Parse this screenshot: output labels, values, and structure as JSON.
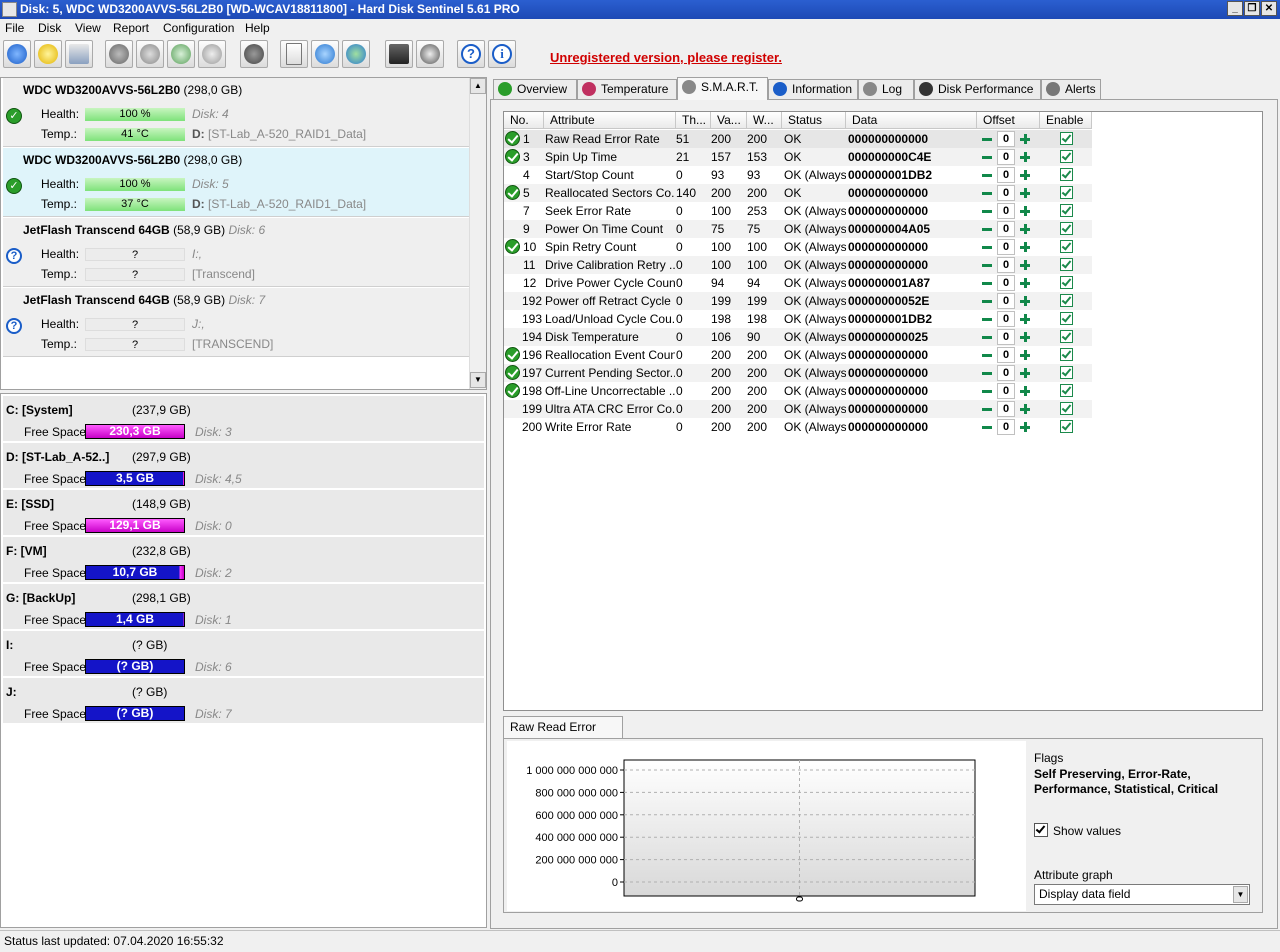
{
  "window": {
    "title": "Disk: 5, WDC WD3200AVVS-56L2B0 [WD-WCAV18811800]  -  Hard Disk Sentinel 5.61 PRO",
    "minimize": "_",
    "restore": "❐",
    "close": "✕"
  },
  "menu": [
    "File",
    "Disk",
    "View",
    "Report",
    "Configuration",
    "Help"
  ],
  "toolbar": {
    "icons": [
      "refresh-icon",
      "warning-icon",
      "disk-icon",
      "disk-gray-icon",
      "disk-info-icon",
      "disk-check-icon",
      "disk-tools-icon",
      "disk-blob-icon",
      "report-icon",
      "update-icon",
      "network-icon",
      "alert-config-icon",
      "sound-icon",
      "help-icon",
      "info-icon"
    ],
    "unregistered": "Unregistered version, please register.",
    "help_glyph": "?",
    "info_glyph": "i"
  },
  "disks": [
    {
      "name": "WDC WD3200AVVS-56L2B0",
      "size": "(298,0 GB)",
      "disk_no": "",
      "status": "ok",
      "health_label": "Health:",
      "health": "100 %",
      "health_info": "Disk: 4",
      "temp_label": "Temp.:",
      "temp": "41 °C",
      "drive": "D:",
      "drive_name": "[ST-Lab_A-520_RAID1_Data]"
    },
    {
      "name": "WDC WD3200AVVS-56L2B0",
      "size": "(298,0 GB)",
      "disk_no": "",
      "status": "ok",
      "selected": true,
      "health_label": "Health:",
      "health": "100 %",
      "health_info": "Disk: 5",
      "temp_label": "Temp.:",
      "temp": "37 °C",
      "drive": "D:",
      "drive_name": "[ST-Lab_A-520_RAID1_Data]"
    },
    {
      "name": "JetFlash Transcend 64GB",
      "size": "(58,9 GB)",
      "disk_no": "Disk: 6",
      "status": "unknown",
      "health_label": "Health:",
      "health": "?",
      "health_info": "I:,",
      "temp_label": "Temp.:",
      "temp": "?",
      "drive": "",
      "drive_name": "[Transcend]"
    },
    {
      "name": "JetFlash Transcend 64GB",
      "size": "(58,9 GB)",
      "disk_no": "Disk: 7",
      "status": "unknown",
      "health_label": "Health:",
      "health": "?",
      "health_info": "J:,",
      "temp_label": "Temp.:",
      "temp": "?",
      "drive": "",
      "drive_name": "[TRANSCEND]"
    }
  ],
  "status_glyphs": {
    "ok": "✓",
    "unknown": "?"
  },
  "scroll_glyphs": {
    "up": "▲",
    "down": "▼"
  },
  "partitions": [
    {
      "name": "C: [System]",
      "size": "(237,9 GB)",
      "free_label": "Free Space",
      "free": "230,3 GB",
      "disk": "Disk: 3",
      "style": "mag"
    },
    {
      "name": "D: [ST-Lab_A-52..]",
      "size": "(297,9 GB)",
      "free_label": "Free Space",
      "free": "3,5 GB",
      "disk": "Disk: 4,5",
      "style": "blue"
    },
    {
      "name": "E: [SSD]",
      "size": "(148,9 GB)",
      "free_label": "Free Space",
      "free": "129,1 GB",
      "disk": "Disk: 0",
      "style": "mag"
    },
    {
      "name": "F: [VM]",
      "size": "(232,8 GB)",
      "free_label": "Free Space",
      "free": "10,7 GB",
      "disk": "Disk: 2",
      "style": "blue"
    },
    {
      "name": "G: [BackUp]",
      "size": "(298,1 GB)",
      "free_label": "Free Space",
      "free": "1,4 GB",
      "disk": "Disk: 1",
      "style": "blue"
    },
    {
      "name": "I:",
      "size": "(? GB)",
      "free_label": "Free Space",
      "free": "(? GB)",
      "disk": "Disk: 6",
      "style": "blue"
    },
    {
      "name": "J:",
      "size": "(? GB)",
      "free_label": "Free Space",
      "free": "(? GB)",
      "disk": "Disk: 7",
      "style": "blue"
    }
  ],
  "statusbar": "Status last updated: 07.04.2020 16:55:32",
  "tabs": [
    {
      "label": "Overview",
      "icon": "ok-icon"
    },
    {
      "label": "Temperature",
      "icon": "thermometer-icon"
    },
    {
      "label": "S.M.A.R.T.",
      "icon": "smart-icon",
      "active": true
    },
    {
      "label": "Information",
      "icon": "info-icon"
    },
    {
      "label": "Log",
      "icon": "log-icon"
    },
    {
      "label": "Disk Performance",
      "icon": "performance-icon"
    },
    {
      "label": "Alerts",
      "icon": "alerts-icon"
    }
  ],
  "smart": {
    "columns": [
      "No.",
      "Attribute",
      "Th...",
      "Va...",
      "W...",
      "Status",
      "Data",
      "Offset",
      "Enable"
    ],
    "offset": "0",
    "rows": [
      {
        "ok": true,
        "no": "1",
        "attr": "Raw Read Error Rate",
        "th": "51",
        "va": "200",
        "w": "200",
        "status": "OK",
        "data": "000000000000"
      },
      {
        "ok": true,
        "no": "3",
        "attr": "Spin Up Time",
        "th": "21",
        "va": "157",
        "w": "153",
        "status": "OK",
        "data": "000000000C4E"
      },
      {
        "ok": false,
        "no": "4",
        "attr": "Start/Stop Count",
        "th": "0",
        "va": "93",
        "w": "93",
        "status": "OK (Always...",
        "data": "000000001DB2"
      },
      {
        "ok": true,
        "no": "5",
        "attr": "Reallocated Sectors Co...",
        "th": "140",
        "va": "200",
        "w": "200",
        "status": "OK",
        "data": "000000000000"
      },
      {
        "ok": false,
        "no": "7",
        "attr": "Seek Error Rate",
        "th": "0",
        "va": "100",
        "w": "253",
        "status": "OK (Always...",
        "data": "000000000000"
      },
      {
        "ok": false,
        "no": "9",
        "attr": "Power On Time Count",
        "th": "0",
        "va": "75",
        "w": "75",
        "status": "OK (Always...",
        "data": "000000004A05"
      },
      {
        "ok": true,
        "no": "10",
        "attr": "Spin Retry Count",
        "th": "0",
        "va": "100",
        "w": "100",
        "status": "OK (Always...",
        "data": "000000000000"
      },
      {
        "ok": false,
        "no": "11",
        "attr": "Drive Calibration Retry ...",
        "th": "0",
        "va": "100",
        "w": "100",
        "status": "OK (Always...",
        "data": "000000000000"
      },
      {
        "ok": false,
        "no": "12",
        "attr": "Drive Power Cycle Count",
        "th": "0",
        "va": "94",
        "w": "94",
        "status": "OK (Always...",
        "data": "000000001A87"
      },
      {
        "ok": false,
        "no": "192",
        "attr": "Power off Retract Cycle ...",
        "th": "0",
        "va": "199",
        "w": "199",
        "status": "OK (Always...",
        "data": "00000000052E"
      },
      {
        "ok": false,
        "no": "193",
        "attr": "Load/Unload Cycle Cou...",
        "th": "0",
        "va": "198",
        "w": "198",
        "status": "OK (Always...",
        "data": "000000001DB2"
      },
      {
        "ok": false,
        "no": "194",
        "attr": "Disk Temperature",
        "th": "0",
        "va": "106",
        "w": "90",
        "status": "OK (Always...",
        "data": "000000000025"
      },
      {
        "ok": true,
        "no": "196",
        "attr": "Reallocation Event Count",
        "th": "0",
        "va": "200",
        "w": "200",
        "status": "OK (Always...",
        "data": "000000000000"
      },
      {
        "ok": true,
        "no": "197",
        "attr": "Current Pending Sector...",
        "th": "0",
        "va": "200",
        "w": "200",
        "status": "OK (Always...",
        "data": "000000000000"
      },
      {
        "ok": true,
        "no": "198",
        "attr": "Off-Line Uncorrectable ...",
        "th": "0",
        "va": "200",
        "w": "200",
        "status": "OK (Always...",
        "data": "000000000000"
      },
      {
        "ok": false,
        "no": "199",
        "attr": "Ultra ATA CRC Error Co...",
        "th": "0",
        "va": "200",
        "w": "200",
        "status": "OK (Always...",
        "data": "000000000000"
      },
      {
        "ok": false,
        "no": "200",
        "attr": "Write Error Rate",
        "th": "0",
        "va": "200",
        "w": "200",
        "status": "OK (Always...",
        "data": "000000000000"
      }
    ]
  },
  "graph": {
    "tab": "Raw Read Error Rate",
    "flags_label": "Flags",
    "flags": "Self Preserving, Error-Rate, Performance, Statistical, Critical",
    "show_values": "Show values",
    "attr_graph_label": "Attribute graph",
    "attr_graph_value": "Display data field",
    "dropdown_glyph": "▼"
  },
  "chart_data": {
    "type": "line",
    "title": "",
    "xlabel": "",
    "ylabel": "",
    "ylim": [
      0,
      1000000000000
    ],
    "yticks": [
      0,
      200000000000,
      400000000000,
      600000000000,
      800000000000,
      1000000000000
    ],
    "ytick_labels": [
      "0",
      "200 000 000 000",
      "400 000 000 000",
      "600 000 000 000",
      "800 000 000 000",
      "1 000 000 000 000"
    ],
    "series": [
      {
        "values": [
          0
        ]
      }
    ],
    "grid": true
  }
}
